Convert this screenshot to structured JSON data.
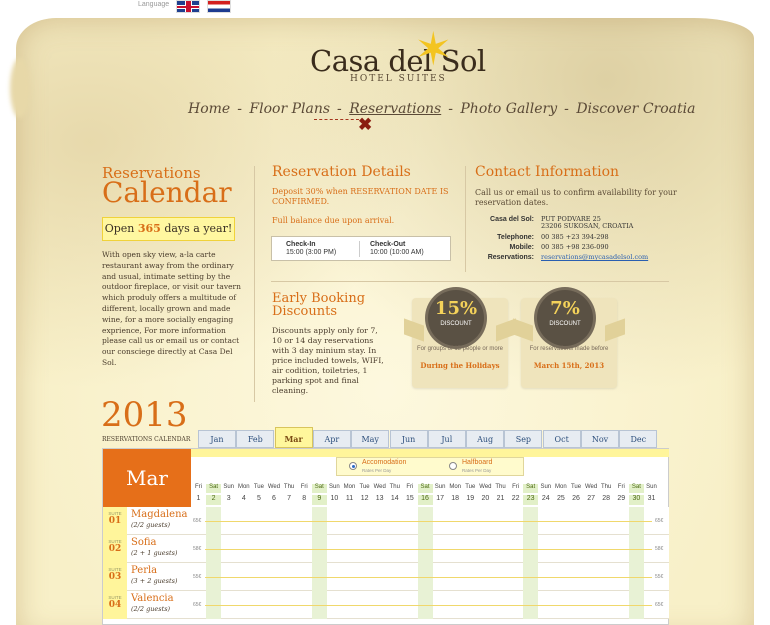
{
  "language": {
    "label": "Language"
  },
  "logo": {
    "name": "Casa del Sol",
    "subtitle": "HOTEL SUITES"
  },
  "nav": [
    "Home",
    "Floor Plans",
    "Reservations",
    "Photo Gallery",
    "Discover Croatia"
  ],
  "nav_sep": "-",
  "calendar_intro": {
    "title1": "Reservations",
    "title2": "Calendar",
    "open_pre": "Open",
    "open_num": "365",
    "open_post": "days a year!",
    "text": "With open sky view, a-la carte restaurant away from the ordinary and usual, intimate setting by the outdoor fireplace, or visit our tavern which produly offers a multitude of different, locally grown and made wine, for a more socially engaging exprience, For more information please call us or email us or contact our consciege directly at Casa Del Sol."
  },
  "reservation_details": {
    "title": "Reservation Details",
    "deposit": "Deposit 30% when RESERVATION DATE IS CONFIRMED.",
    "balance": "Full balance due upon arrival.",
    "checkin_label": "Check-In",
    "checkin_time": "15:00 (3:00 PM)",
    "checkout_label": "Check-Out",
    "checkout_time": "10:00 (10:00 AM)"
  },
  "contact": {
    "title": "Contact Information",
    "text": "Call us or email us to confirm availability for your reservation dates.",
    "name_label": "Casa del Sol:",
    "address1": "PUT PODVARE 25",
    "address2": "23206 SUKOSAN, CROATIA",
    "tel_label": "Telephone:",
    "tel": "00 385 +23 394-298",
    "mobile_label": "Mobile:",
    "mobile": "00 385 +98 236-090",
    "res_label": "Reservations:",
    "email": "reservations@mycasadelsol.com"
  },
  "early": {
    "title1": "Early Booking",
    "title2": "Discounts",
    "text": "Discounts apply only for 7, 10 or 14 day reservations with 3 day minium stay. In price included towels, WIFI, air codition, toiletries, 1 parking spot and final cleaning.",
    "d1_pct": "15%",
    "d1_label": "DISCOUNT",
    "d1_small": "For groups of 15 people or more",
    "d1_strong": "During the Holidays",
    "d2_pct": "7%",
    "d2_label": "DISCOUNT",
    "d2_small": "For reservations made before",
    "d2_strong": "March 15th, 2013"
  },
  "year": {
    "value": "2013",
    "sub": "RESERVATIONS CALENDAR"
  },
  "months": [
    "Jan",
    "Feb",
    "Mar",
    "Apr",
    "May",
    "Jun",
    "Jul",
    "Aug",
    "Sep",
    "Oct",
    "Nov",
    "Dec"
  ],
  "active_month": "Mar",
  "board": {
    "option1": "Accomodation",
    "option1_sub": "Rates Per Day",
    "option2": "Halfboard",
    "option2_sub": "Rates Per Day"
  },
  "day_names": [
    "Fri",
    "Sat",
    "Sun",
    "Mon",
    "Tue",
    "Wed",
    "Thu",
    "Fri",
    "Sat",
    "Sun",
    "Mon",
    "Tue",
    "Wed",
    "Thu",
    "Fri",
    "Sat",
    "Sun",
    "Mon",
    "Tue",
    "Wed",
    "Thu",
    "Fri",
    "Sat",
    "Sun",
    "Mon",
    "Tue",
    "Wed",
    "Thu",
    "Fri",
    "Sat",
    "Sun"
  ],
  "day_numbers": [
    "1",
    "2",
    "3",
    "4",
    "5",
    "6",
    "7",
    "8",
    "9",
    "10",
    "11",
    "12",
    "13",
    "14",
    "15",
    "16",
    "17",
    "18",
    "19",
    "20",
    "21",
    "22",
    "23",
    "24",
    "25",
    "26",
    "27",
    "28",
    "29",
    "30",
    "31"
  ],
  "suites": [
    {
      "num": "01",
      "name": "Magdalena",
      "guests": "(2/2 guests)",
      "price": "65€"
    },
    {
      "num": "02",
      "name": "Sofia",
      "guests": "(2 + 1 guests)",
      "price": "58€"
    },
    {
      "num": "03",
      "name": "Perla",
      "guests": "(3 + 2 guests)",
      "price": "55€"
    },
    {
      "num": "04",
      "name": "Valencia",
      "guests": "(2/2 guests)",
      "price": "65€"
    }
  ],
  "suite_label": "SUITE"
}
